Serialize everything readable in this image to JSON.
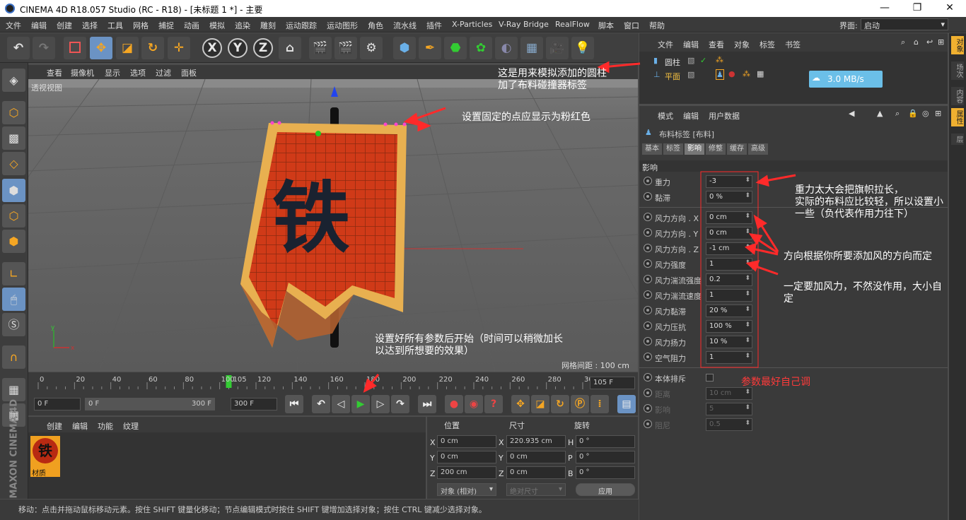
{
  "titlebar": {
    "title": "CINEMA 4D R18.057 Studio (RC - R18) - [未标题 1 *] - 主要",
    "min": "—",
    "max": "❐",
    "close": "✕"
  },
  "menubar": {
    "items": [
      "文件",
      "编辑",
      "创建",
      "选择",
      "工具",
      "网格",
      "捕捉",
      "动画",
      "模拟",
      "追染",
      "雕刻",
      "运动跟踪",
      "运动图形",
      "角色",
      "流水线",
      "插件",
      "X-Particles",
      "V-Ray Bridge",
      "RealFlow",
      "脚本",
      "窗口",
      "帮助"
    ],
    "interface_label": "界面:",
    "interface_value": "启动"
  },
  "toolbar": {
    "undo": "↶",
    "redo": "↷",
    "x": "X",
    "y": "Y",
    "z": "Z"
  },
  "viewport": {
    "menu": [
      "查看",
      "摄像机",
      "显示",
      "选项",
      "过滤",
      "面板"
    ],
    "view_label": "透视视图",
    "grid_label": "网格间距 : 100 cm",
    "banner_char": "铁",
    "axis_y": "y",
    "axis_x": "x"
  },
  "timeline": {
    "ticks": [
      "0",
      "20",
      "40",
      "60",
      "80",
      "100",
      "105",
      "120",
      "140",
      "160",
      "180",
      "200",
      "220",
      "240",
      "260",
      "280",
      "300"
    ],
    "current_frame": "105 F",
    "current_value": 105,
    "max_value": 300
  },
  "playbar": {
    "start": "0 F",
    "range_start": "0 F",
    "range_end": "300 F",
    "end": "300 F"
  },
  "material": {
    "menu": [
      "创建",
      "编辑",
      "功能",
      "纹理"
    ],
    "name": "材质",
    "thumb_char": "铁"
  },
  "coords": {
    "headers": [
      "位置",
      "尺寸",
      "旋转"
    ],
    "rows": [
      {
        "a": "X",
        "p": "0 cm",
        "b": "X",
        "s": "220.935 cm",
        "c": "H",
        "r": "0 °"
      },
      {
        "a": "Y",
        "p": "0 cm",
        "b": "Y",
        "s": "0 cm",
        "c": "P",
        "r": "0 °"
      },
      {
        "a": "Z",
        "p": "200 cm",
        "b": "Z",
        "s": "0 cm",
        "c": "B",
        "r": "0 °"
      }
    ],
    "mode": "对象 (相对)",
    "size_mode": "绝对尺寸",
    "apply": "应用"
  },
  "status": "移动：点击并拖动鼠标移动元素。按住 SHIFT 键量化移动；节点编辑模式时按住 SHIFT 键增加选择对象；按住 CTRL 键减少选择对象。",
  "objects": {
    "menu": [
      "文件",
      "编辑",
      "查看",
      "对象",
      "标签",
      "书签"
    ],
    "items": [
      {
        "name": "圆柱"
      },
      {
        "name": "平面"
      }
    ],
    "net_speed": "3.0 MB/s"
  },
  "attributes": {
    "menu": [
      "模式",
      "编辑",
      "用户数据"
    ],
    "title": "布料标签 [布料]",
    "tabs": [
      "基本",
      "标签",
      "影响",
      "修整",
      "缓存",
      "高级"
    ],
    "section": "影响",
    "params": [
      {
        "label": "重力",
        "value": "-3"
      },
      {
        "label": "黏滞",
        "value": "0 %"
      },
      {
        "label": "风力方向 . X",
        "value": "0 cm"
      },
      {
        "label": "风力方向 . Y",
        "value": "0 cm"
      },
      {
        "label": "风力方向 . Z",
        "value": "-1 cm"
      },
      {
        "label": "风力强度",
        "value": "1"
      },
      {
        "label": "风力湍流强度",
        "value": "0.2"
      },
      {
        "label": "风力湍流速度",
        "value": "1"
      },
      {
        "label": "风力黏滞",
        "value": "20 %"
      },
      {
        "label": "风力压抗",
        "value": "100 %"
      },
      {
        "label": "风力扬力",
        "value": "10 %"
      },
      {
        "label": "空气阻力",
        "value": "1"
      }
    ],
    "self_collision": "本体排斥",
    "disabled": [
      {
        "label": "距离",
        "value": "10 cm"
      },
      {
        "label": "影响",
        "value": "5"
      },
      {
        "label": "阻尼",
        "value": "0.5"
      }
    ]
  },
  "right_tabs": [
    "对象",
    "场次",
    "内容",
    "属性",
    "层"
  ],
  "annotations": {
    "cylinder": "这是用来模拟添加的圆柱\n加了布料碰撞器标签",
    "pinned": "设置固定的点应显示为粉红色",
    "start": "设置好所有参数后开始（时间可以稍微加长\n以达到所想要的效果）",
    "gravity": "重力太大会把旗帜拉长，\n实际的布料应比较轻，所以设置小\n一些（负代表作用力往下）",
    "direction": "方向根据你所要添加风的方向而定",
    "strength": "一定要加风力，不然没作用，大小自\n定",
    "tune": "参数最好自己调"
  }
}
